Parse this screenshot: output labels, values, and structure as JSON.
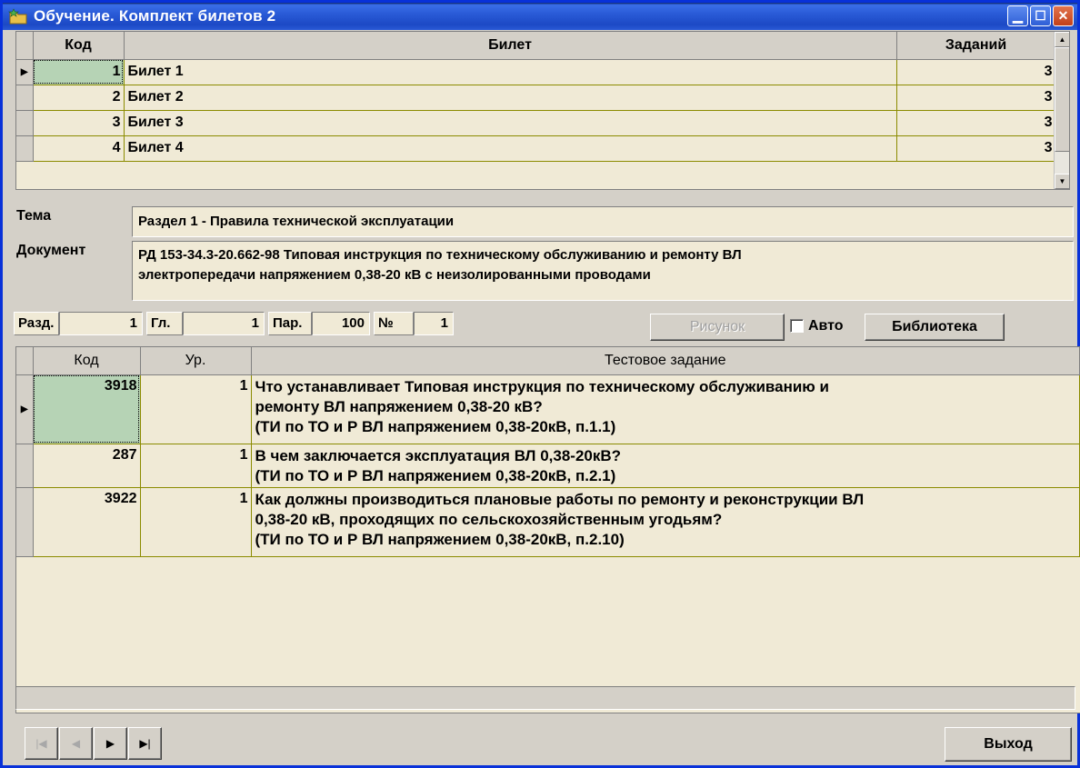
{
  "window": {
    "title": "Обучение. Комплект билетов 2",
    "icons": {
      "app": "folder-star-icon",
      "minimize": "minimize-icon",
      "maximize": "maximize-icon",
      "close": "close-icon"
    }
  },
  "tickets_grid": {
    "headers": {
      "code": "Код",
      "ticket": "Билет",
      "tasks": "Заданий"
    },
    "rows": [
      {
        "code": "1",
        "ticket": "Билет 1",
        "tasks": "3"
      },
      {
        "code": "2",
        "ticket": "Билет 2",
        "tasks": "3"
      },
      {
        "code": "3",
        "ticket": "Билет 3",
        "tasks": "3"
      },
      {
        "code": "4",
        "ticket": "Билет 4",
        "tasks": "3"
      }
    ]
  },
  "info": {
    "topic_label": "Тема",
    "topic_value": "Раздел 1 - Правила технической эксплуатации",
    "document_label": "Документ",
    "document_line1": "РД 153-34.3-20.662-98 Типовая инструкция по техническому обслуживанию и  ремонту ВЛ",
    "document_line2": "электропередачи напряжением 0,38-20 кВ с неизолированными проводами"
  },
  "filters": {
    "section_label": "Разд.",
    "section_value": "1",
    "chapter_label": "Гл.",
    "chapter_value": "1",
    "paragraph_label": "Пар.",
    "paragraph_value": "100",
    "number_label": "№",
    "number_value": "1",
    "picture_button": "Рисунок",
    "auto_label": "Авто",
    "library_button": "Библиотека"
  },
  "tasks_grid": {
    "headers": {
      "code": "Код",
      "level": "Ур.",
      "task": "Тестовое задание"
    },
    "rows": [
      {
        "code": "3918",
        "level": "1",
        "line1": "Что устанавливает Типовая инструкция по техническому обслуживанию и",
        "line2": "ремонту ВЛ напряжением 0,38-20 кВ?",
        "line3": "(ТИ по ТО и Р ВЛ напряжением 0,38-20кВ, п.1.1)"
      },
      {
        "code": "287",
        "level": "1",
        "line1": "В чем заключается эксплуатация ВЛ 0,38-20кВ?",
        "line2": "(ТИ по ТО и Р ВЛ напряжением 0,38-20кВ, п.2.1)"
      },
      {
        "code": "3922",
        "level": "1",
        "line1": "Как должны производиться плановые работы по  ремонту и реконструкции ВЛ",
        "line2": "0,38-20 кВ, проходящих по сельскохозяйственным угодьям?",
        "line3": "(ТИ по ТО и Р ВЛ напряжением 0,38-20кВ, п.2.10)"
      }
    ]
  },
  "navigator": {
    "first": "first-record-icon",
    "prior": "prior-record-icon",
    "next": "next-record-icon",
    "last": "last-record-icon"
  },
  "exit_button": "Выход"
}
